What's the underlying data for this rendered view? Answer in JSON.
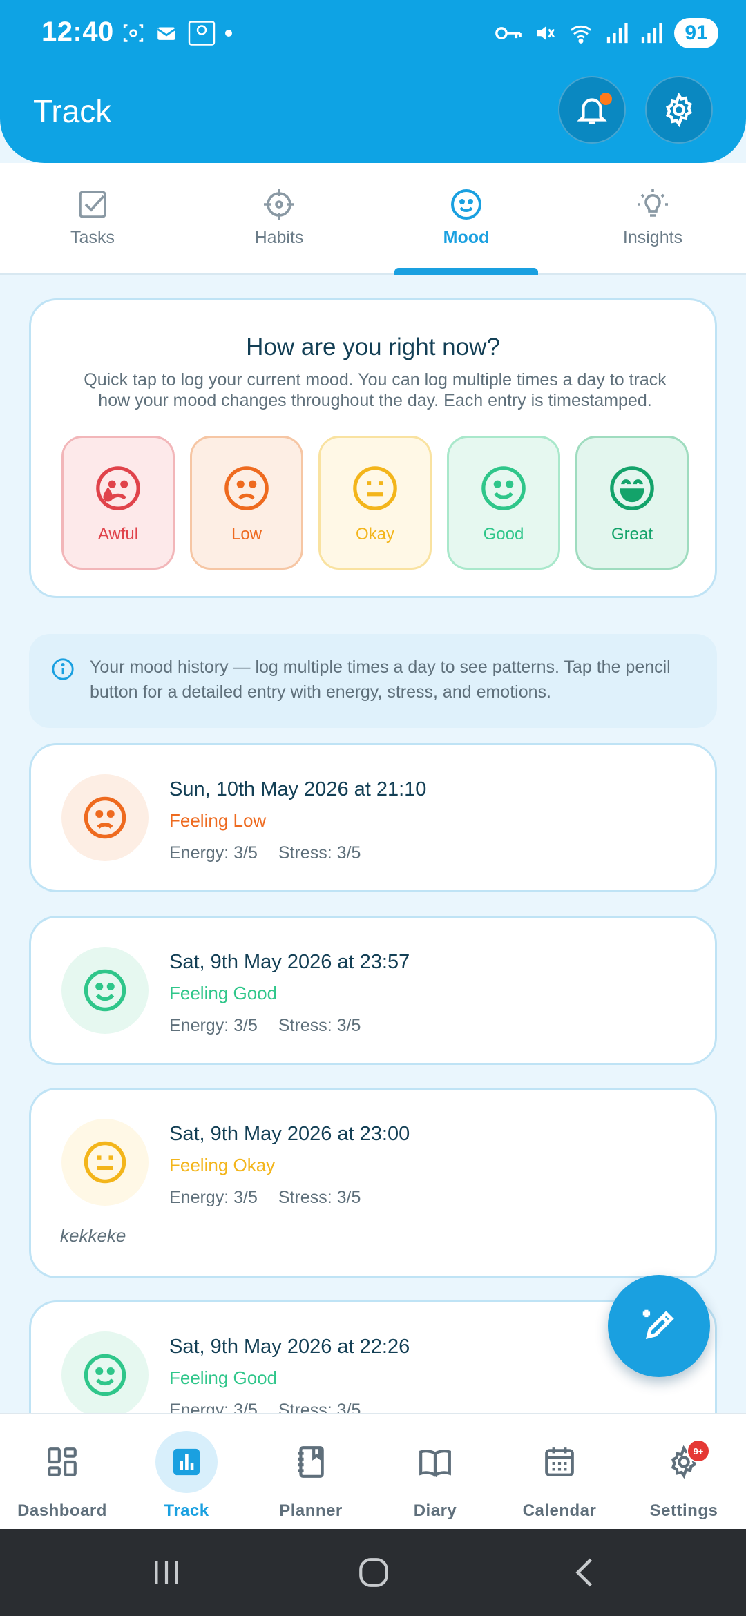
{
  "status_bar": {
    "time": "12:40",
    "battery": "91"
  },
  "header": {
    "title": "Track"
  },
  "tabs": [
    {
      "label": "Tasks"
    },
    {
      "label": "Habits"
    },
    {
      "label": "Mood"
    },
    {
      "label": "Insights"
    }
  ],
  "active_tab": "Mood",
  "log_card": {
    "title": "How are you right now?",
    "description": "Quick tap to log your current mood. You can log multiple times a day to track how your mood changes throughout the day. Each entry is timestamped.",
    "moods": [
      {
        "label": "Awful",
        "color": "#e0434b",
        "bg": "#fde9ea",
        "border": "#f2b6b9"
      },
      {
        "label": "Low",
        "color": "#ee6a1f",
        "bg": "#fdeee4",
        "border": "#f6c6a4"
      },
      {
        "label": "Okay",
        "color": "#f3b51b",
        "bg": "#fff8e6",
        "border": "#f9e2a0"
      },
      {
        "label": "Good",
        "color": "#2fc68a",
        "bg": "#e6f8f0",
        "border": "#a9e8cb"
      },
      {
        "label": "Great",
        "color": "#13a36a",
        "bg": "#e3f6ee",
        "border": "#9fdcbf"
      }
    ]
  },
  "info": {
    "text": "Your mood history — log multiple times a day to see patterns. Tap the pencil button for a detailed entry with energy, stress, and emotions."
  },
  "entries": [
    {
      "date": "Sun, 10th May 2026 at 21:10",
      "feeling": "Feeling Low",
      "energy": "Energy: 3/5",
      "stress": "Stress: 3/5",
      "note": "",
      "color": "#ee6a1f",
      "bg": "#fdeee4"
    },
    {
      "date": "Sat, 9th May 2026 at 23:57",
      "feeling": "Feeling Good",
      "energy": "Energy: 3/5",
      "stress": "Stress: 3/5",
      "note": "",
      "color": "#2fc68a",
      "bg": "#e6f8f0"
    },
    {
      "date": "Sat, 9th May 2026 at 23:00",
      "feeling": "Feeling Okay",
      "energy": "Energy: 3/5",
      "stress": "Stress: 3/5",
      "note": "kekkeke",
      "color": "#f3b51b",
      "bg": "#fff8e6"
    },
    {
      "date": "Sat, 9th May 2026 at 22:26",
      "feeling": "Feeling Good",
      "energy": "Energy: 3/5",
      "stress": "Stress: 3/5",
      "note": "",
      "color": "#2fc68a",
      "bg": "#e6f8f0"
    }
  ],
  "bottom_nav": [
    {
      "label": "Dashboard"
    },
    {
      "label": "Track"
    },
    {
      "label": "Planner"
    },
    {
      "label": "Diary"
    },
    {
      "label": "Calendar"
    },
    {
      "label": "Settings"
    }
  ],
  "settings_badge": "9+",
  "colors": {
    "primary": "#0ea3e4",
    "accent": "#1aa0e0",
    "notification": "#ff7a1a"
  }
}
